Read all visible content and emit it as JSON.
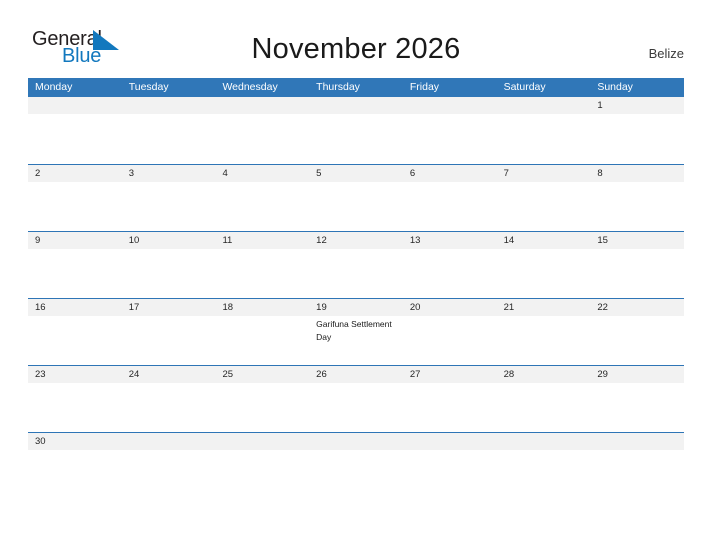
{
  "brand": {
    "name_part1": "General",
    "name_part2": "Blue",
    "flag_icon": "blue-flag-triangle",
    "color_dark": "#231f20",
    "color_blue": "#1278be"
  },
  "header": {
    "title": "November 2026",
    "region": "Belize"
  },
  "theme": {
    "header_blue": "#3077b8",
    "line_blue": "#2e75b6",
    "band_gray": "#f2f2f2",
    "text_dark": "#262626"
  },
  "calendar": {
    "weekdays": [
      "Monday",
      "Tuesday",
      "Wednesday",
      "Thursday",
      "Friday",
      "Saturday",
      "Sunday"
    ],
    "weeks": [
      {
        "days": [
          {
            "num": "",
            "events": []
          },
          {
            "num": "",
            "events": []
          },
          {
            "num": "",
            "events": []
          },
          {
            "num": "",
            "events": []
          },
          {
            "num": "",
            "events": []
          },
          {
            "num": "",
            "events": []
          },
          {
            "num": "1",
            "events": []
          }
        ]
      },
      {
        "days": [
          {
            "num": "2",
            "events": []
          },
          {
            "num": "3",
            "events": []
          },
          {
            "num": "4",
            "events": []
          },
          {
            "num": "5",
            "events": []
          },
          {
            "num": "6",
            "events": []
          },
          {
            "num": "7",
            "events": []
          },
          {
            "num": "8",
            "events": []
          }
        ]
      },
      {
        "days": [
          {
            "num": "9",
            "events": []
          },
          {
            "num": "10",
            "events": []
          },
          {
            "num": "11",
            "events": []
          },
          {
            "num": "12",
            "events": []
          },
          {
            "num": "13",
            "events": []
          },
          {
            "num": "14",
            "events": []
          },
          {
            "num": "15",
            "events": []
          }
        ]
      },
      {
        "days": [
          {
            "num": "16",
            "events": []
          },
          {
            "num": "17",
            "events": []
          },
          {
            "num": "18",
            "events": []
          },
          {
            "num": "19",
            "events": [
              "Garifuna Settlement Day"
            ]
          },
          {
            "num": "20",
            "events": []
          },
          {
            "num": "21",
            "events": []
          },
          {
            "num": "22",
            "events": []
          }
        ]
      },
      {
        "days": [
          {
            "num": "23",
            "events": []
          },
          {
            "num": "24",
            "events": []
          },
          {
            "num": "25",
            "events": []
          },
          {
            "num": "26",
            "events": []
          },
          {
            "num": "27",
            "events": []
          },
          {
            "num": "28",
            "events": []
          },
          {
            "num": "29",
            "events": []
          }
        ]
      },
      {
        "short": true,
        "days": [
          {
            "num": "30",
            "events": []
          },
          {
            "num": "",
            "events": []
          },
          {
            "num": "",
            "events": []
          },
          {
            "num": "",
            "events": []
          },
          {
            "num": "",
            "events": []
          },
          {
            "num": "",
            "events": []
          },
          {
            "num": "",
            "events": []
          }
        ]
      }
    ]
  }
}
